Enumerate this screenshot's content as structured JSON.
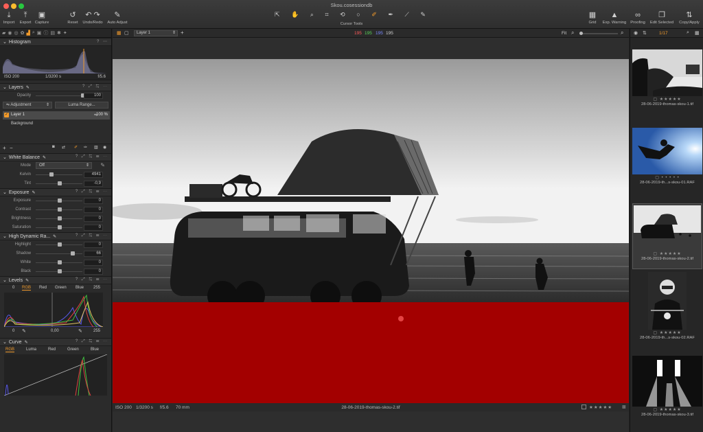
{
  "window": {
    "title": "Skou.cosessiondb"
  },
  "toolbar": {
    "import": "Import",
    "export": "Export",
    "capture": "Capture",
    "reset": "Reset",
    "undo_redo": "Undo/Redo",
    "auto_adjust": "Auto Adjust",
    "cursor_tools": "Cursor Tools",
    "grid": "Grid",
    "exp_warning": "Exp. Warning",
    "proofing": "Proofing",
    "edit_selected": "Edit Selected",
    "copy_apply": "Copy/Apply"
  },
  "histogram": {
    "title": "Histogram",
    "iso": "ISO 200",
    "shutter": "1/3200 s",
    "aperture": "f/5.6",
    "help": "?",
    "more": "⋯"
  },
  "layers": {
    "title": "Layers",
    "opacity_label": "Opacity",
    "opacity_value": "100",
    "adjustment_label": "Adjustment",
    "luma_range_label": "Luma Range...",
    "items": [
      {
        "name": "Layer 1",
        "value": "100 %",
        "checked": true
      },
      {
        "name": "Background"
      }
    ]
  },
  "white_balance": {
    "title": "White Balance",
    "mode_label": "Mode",
    "mode_value": "Off",
    "kelvin_label": "Kelvin",
    "kelvin_value": "4941",
    "tint_label": "Tint",
    "tint_value": "-0,9"
  },
  "exposure": {
    "title": "Exposure",
    "sliders": [
      {
        "label": "Exposure",
        "value": "0"
      },
      {
        "label": "Contrast",
        "value": "0"
      },
      {
        "label": "Brightness",
        "value": "0"
      },
      {
        "label": "Saturation",
        "value": "0"
      }
    ]
  },
  "hdr": {
    "title": "High Dynamic Ra...",
    "sliders": [
      {
        "label": "Highlight",
        "value": "0"
      },
      {
        "label": "Shadow",
        "value": "66"
      },
      {
        "label": "White",
        "value": "0"
      },
      {
        "label": "Black",
        "value": "0"
      }
    ]
  },
  "levels": {
    "title": "Levels",
    "input_low": "0",
    "input_high": "255",
    "channels": [
      "RGB",
      "Red",
      "Green",
      "Blue"
    ],
    "out_low": "0",
    "mid": "0,00",
    "out_high": "255"
  },
  "curve": {
    "title": "Curve",
    "channels": [
      "RGB",
      "Luma",
      "Red",
      "Green",
      "Blue"
    ]
  },
  "viewer": {
    "layer_select": "Layer 1",
    "rgb": {
      "r": "195",
      "g": "195",
      "b": "195",
      "l": "195"
    },
    "fit": "Fit",
    "filename": "28-06-2019-thomas-skou-2.tif",
    "status": {
      "iso": "ISO 200",
      "shutter": "1/3200 s",
      "aperture": "f/5.6",
      "focal": "70 mm"
    },
    "stars": "★★★★★"
  },
  "browser": {
    "counter": "1/17",
    "thumbs": [
      {
        "name": "28-06-2019-thomas-skou-1.tif",
        "stars": "★★★★★"
      },
      {
        "name": "28-06-2019-th...s-skou-01.RAF",
        "stars": "• • • • •"
      },
      {
        "name": "28-06-2019-thomas-skou-2.tif",
        "stars": "★★★★★"
      },
      {
        "name": "28-06-2019-th...s-skou-02.RAF",
        "stars": "★★★★★"
      },
      {
        "name": "28-06-2019-thomas-skou-3.tif",
        "stars": "★★★★★"
      }
    ]
  },
  "colors": {
    "accent": "#f19a2b",
    "mask": "#c00000",
    "selected": "#5a5a5a"
  }
}
